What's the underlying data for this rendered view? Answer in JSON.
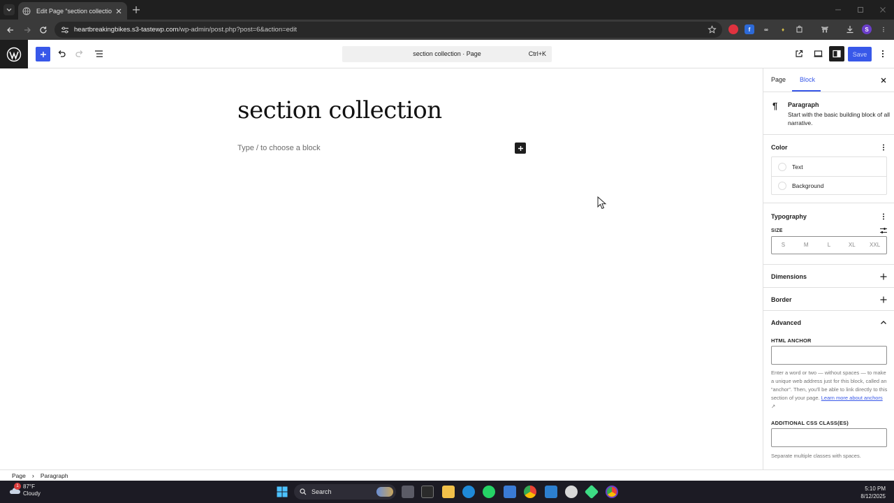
{
  "browser": {
    "tab_title": "Edit Page “section collection” ‹",
    "url_host": "heartbreakingbikes.s3-tastewp.com",
    "url_path": "/wp-admin/post.php?post=6&action=edit",
    "profile_initial": "S"
  },
  "editor": {
    "command_title": "section collection · Page",
    "command_shortcut": "Ctrl+K",
    "save_label": "Save",
    "post_title": "section collection",
    "block_placeholder": "Type / to choose a block"
  },
  "sidebar": {
    "tabs": [
      "Page",
      "Block"
    ],
    "active_tab": "Block",
    "block_name": "Paragraph",
    "block_description": "Start with the basic building block of all narrative.",
    "color": {
      "title": "Color",
      "items": [
        "Text",
        "Background"
      ]
    },
    "typography": {
      "title": "Typography",
      "size_label": "SIZE",
      "sizes": [
        "S",
        "M",
        "L",
        "XL",
        "XXL"
      ]
    },
    "dimensions_title": "Dimensions",
    "border_title": "Border",
    "advanced": {
      "title": "Advanced",
      "anchor_label": "HTML ANCHOR",
      "anchor_value": "",
      "anchor_help": "Enter a word or two — without spaces — to make a unique web address just for this block, called an “anchor”. Then, you'll be able to link directly to this section of your page.",
      "anchor_link": "Learn more about anchors",
      "css_label": "ADDITIONAL CSS CLASS(ES)",
      "css_value": "",
      "css_help": "Separate multiple classes with spaces."
    }
  },
  "breadcrumb": [
    "Page",
    "Paragraph"
  ],
  "taskbar": {
    "temperature": "87°F",
    "condition": "Cloudy",
    "weather_badge": "1",
    "search_label": "Search",
    "time": "5:10 PM",
    "date": "8/12/2025"
  },
  "colors": {
    "wp_blue": "#3858e9",
    "chrome_dark": "#1f1f1f",
    "chrome_toolbar": "#3a3a3a",
    "taskbar": "#1c1b24"
  }
}
